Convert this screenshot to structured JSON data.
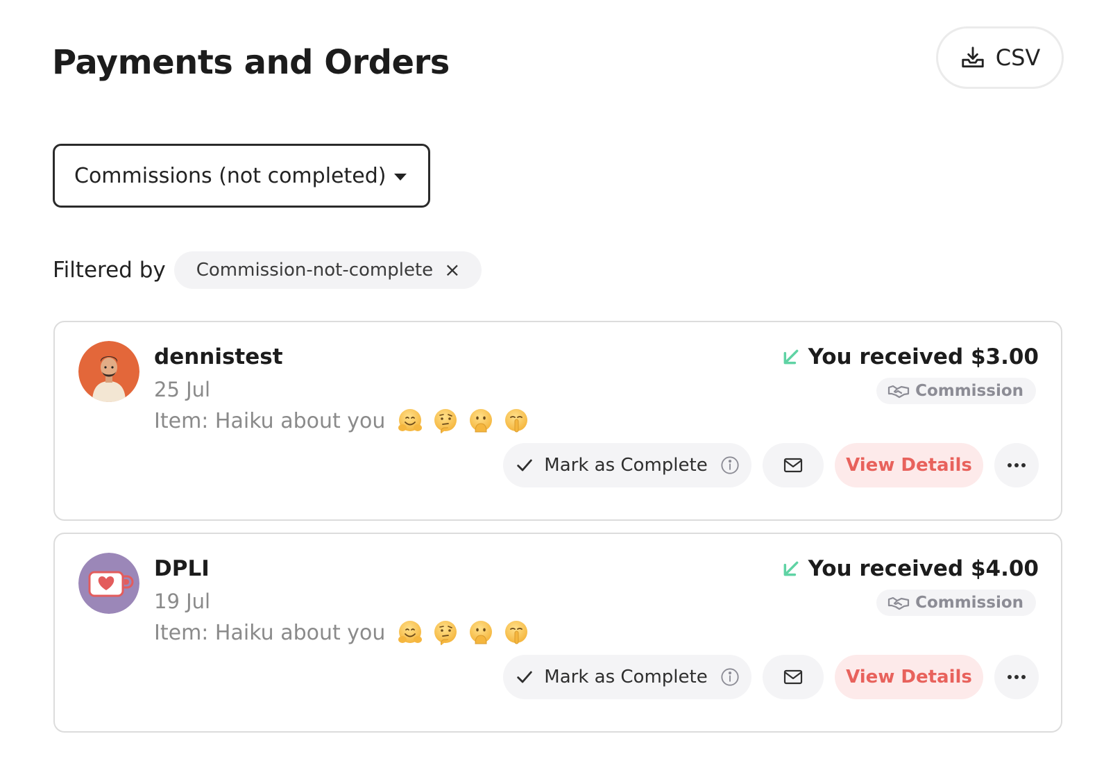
{
  "header": {
    "title": "Payments and Orders",
    "csv_label": "CSV"
  },
  "dropdown": {
    "selected": "Commissions (not completed)"
  },
  "filter": {
    "label": "Filtered by",
    "chip": "Commission-not-complete",
    "close_glyph": "×"
  },
  "orders": [
    {
      "name": "dennistest",
      "date": "25 Jul",
      "item": "Item: Haiku about you",
      "amount": "You received $3.00",
      "type": "Commission",
      "mark_complete": "Mark as Complete",
      "view_details": "View Details",
      "avatar_color": "#e3673a"
    },
    {
      "name": "DPLI",
      "date": "19 Jul",
      "item": "Item: Haiku about you",
      "amount": "You received $4.00",
      "type": "Commission",
      "mark_complete": "Mark as Complete",
      "view_details": "View Details",
      "avatar_color": "#9b87b8"
    }
  ],
  "colors": {
    "accent_red": "#e8625c",
    "received_green": "#5fd3a4",
    "chip_bg": "#f3f3f5"
  },
  "icons": [
    "download-icon",
    "caret-down-icon",
    "close-icon",
    "arrow-down-left-icon",
    "handshake-icon",
    "check-icon",
    "info-icon",
    "mail-icon",
    "more-icon"
  ],
  "emojis": [
    "hugging-face",
    "thinking-face",
    "face-with-hand-over-mouth",
    "shushing-face"
  ]
}
